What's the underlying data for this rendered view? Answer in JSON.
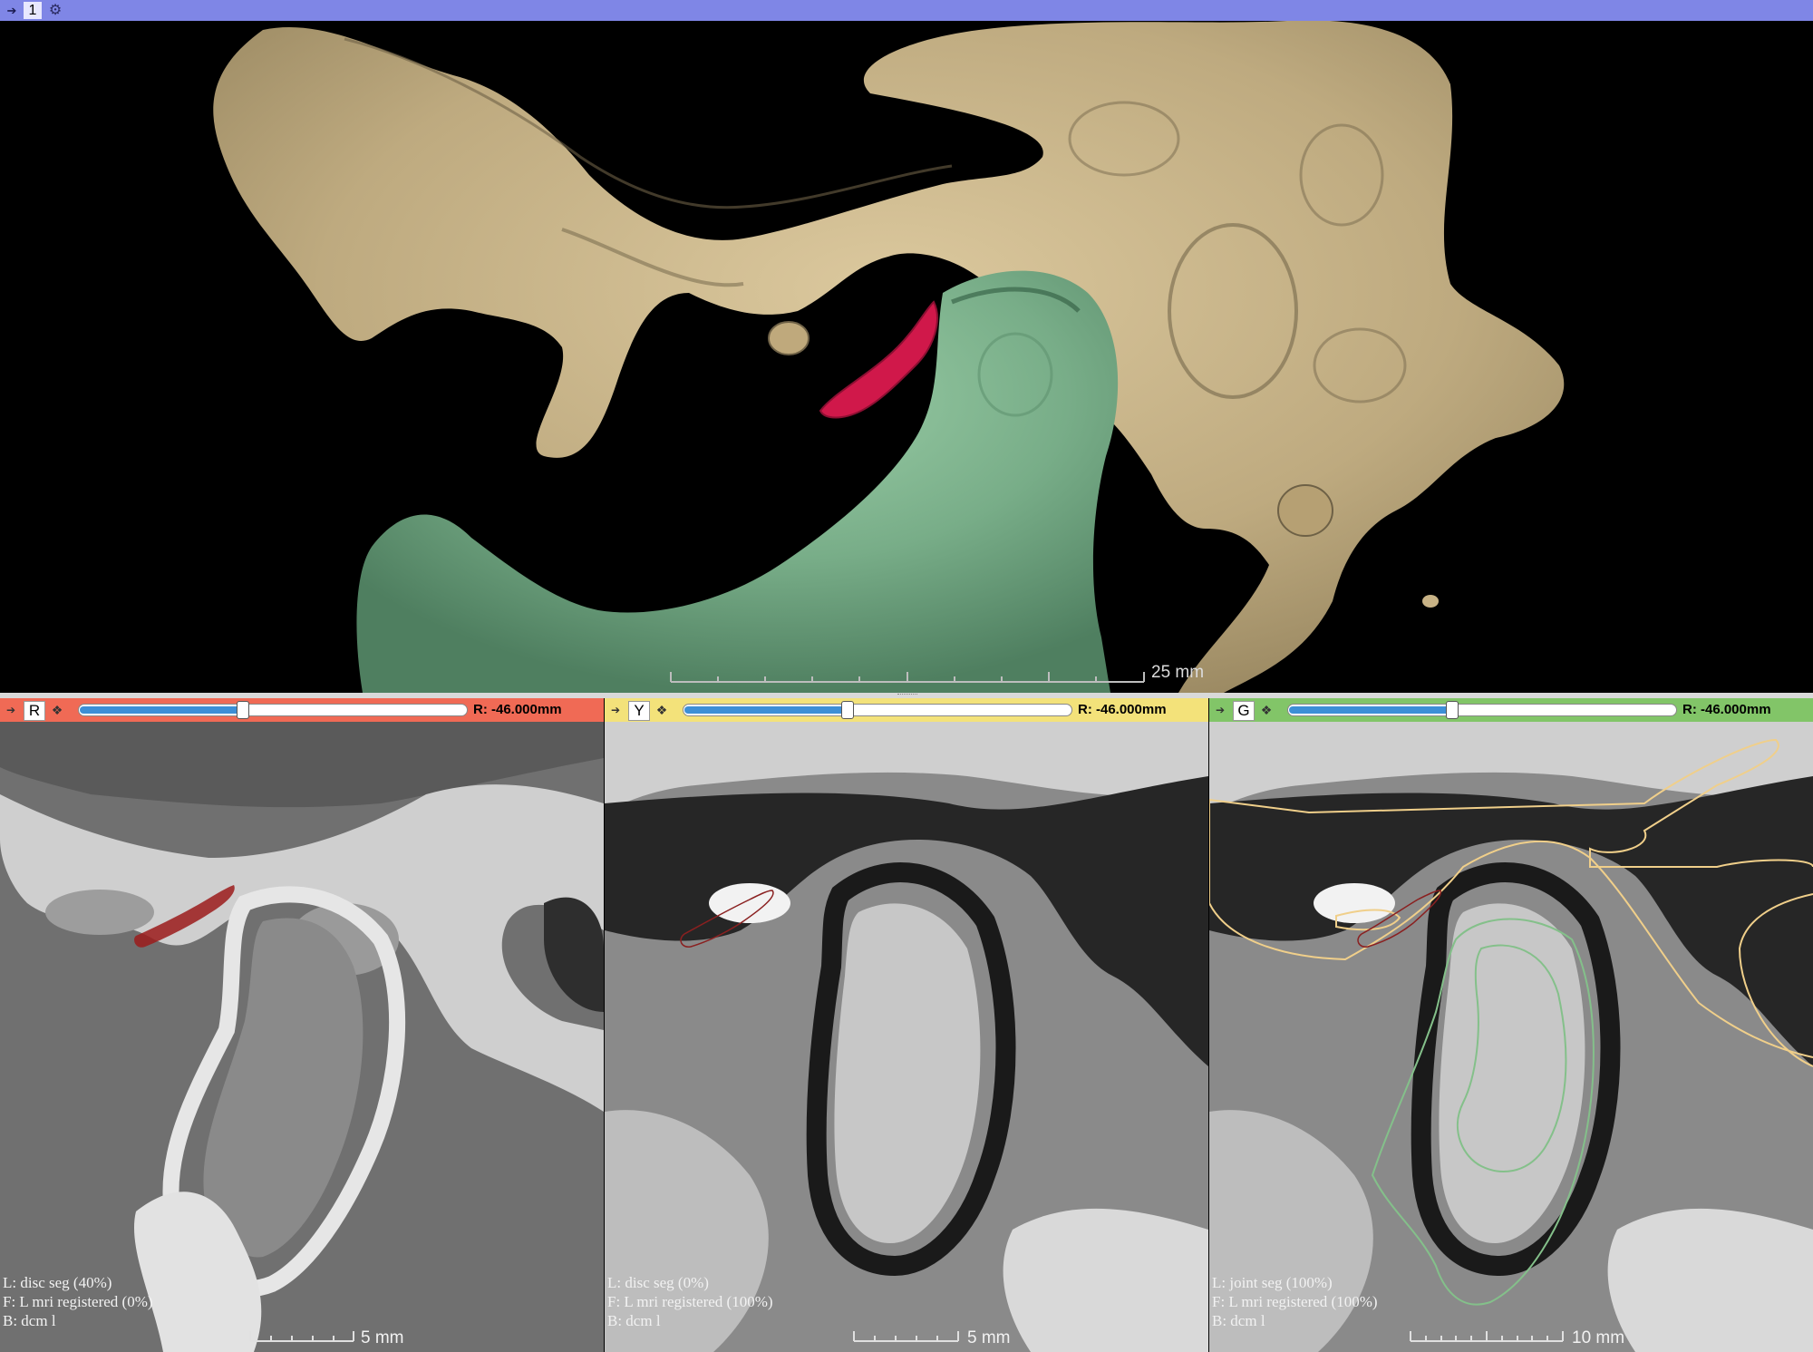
{
  "view3d": {
    "layout_number": "1",
    "pin_icon": "pin-icon",
    "settings_icon": "gear-icon",
    "scale_label": "25 mm",
    "colors": {
      "bar": "#7f86e6",
      "bone": "#c9b58a",
      "condyle": "#7fb58f",
      "disc": "#d0184a"
    }
  },
  "slices": [
    {
      "id": "red",
      "letter": "R",
      "bar_color": "#f06a55",
      "offset": "R: -46.000mm",
      "slider_fraction": 0.42,
      "annotations": [
        "L: disc seg (40%)",
        "F: L mri registered (0%)",
        "B: dcm l"
      ],
      "scale_label": "5 mm"
    },
    {
      "id": "yellow",
      "letter": "Y",
      "bar_color": "#f3e27a",
      "offset": "R: -46.000mm",
      "slider_fraction": 0.42,
      "annotations": [
        "L: disc seg (0%)",
        "F: L mri registered (100%)",
        "B: dcm l"
      ],
      "scale_label": "5 mm"
    },
    {
      "id": "green",
      "letter": "G",
      "bar_color": "#82c568",
      "offset": "R: -46.000mm",
      "slider_fraction": 0.42,
      "annotations": [
        "L: joint seg (100%)",
        "F: L mri registered (100%)",
        "B: dcm l"
      ],
      "scale_label": "10 mm"
    }
  ]
}
